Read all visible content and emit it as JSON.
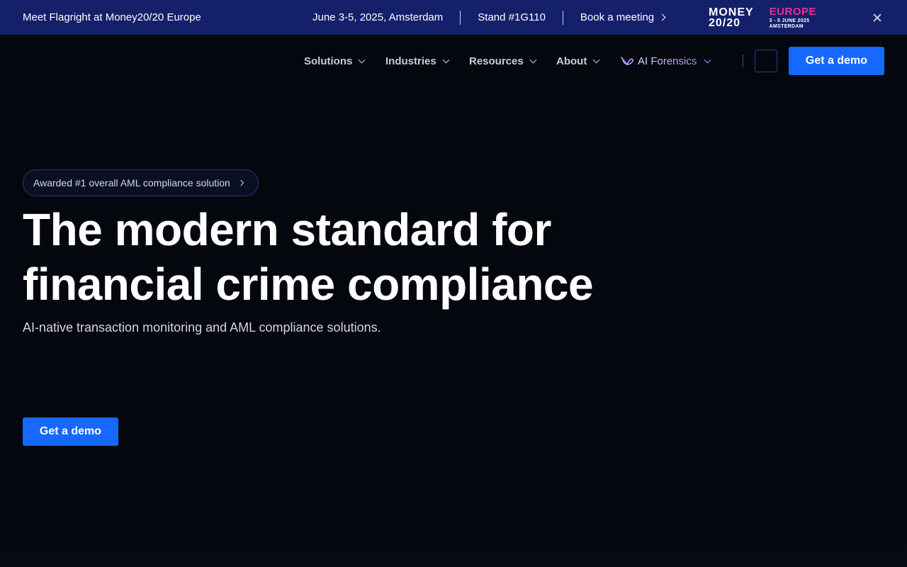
{
  "announcement": {
    "text": "Meet Flagright at Money20/20 Europe",
    "date_location": "June 3-5, 2025, Amsterdam",
    "stand": "Stand #1G110",
    "book_label": "Book a meeting",
    "event_logo": {
      "money_line1": "MONEY",
      "money_line2": "20/20",
      "region": "EUROPE",
      "dates": "3 - 5 JUNE 2025",
      "city": "AMSTERDAM"
    },
    "colors": {
      "background": "#14206a",
      "accent": "#e8318f"
    }
  },
  "nav": {
    "items": [
      {
        "label": "Solutions",
        "icon": "chevron-down-icon"
      },
      {
        "label": "Industries",
        "icon": "chevron-down-icon"
      },
      {
        "label": "Resources",
        "icon": "chevron-down-icon"
      },
      {
        "label": "About",
        "icon": "chevron-down-icon"
      }
    ],
    "ai_forensics": {
      "label": "AI Forensics",
      "icon": "ai-forensics-icon"
    },
    "cta_label": "Get a demo"
  },
  "hero": {
    "badge": "Awarded #1 overall AML compliance solution",
    "title_line1": "The modern standard for",
    "title_line2": "financial crime compliance",
    "subtitle": "AI-native transaction monitoring and AML compliance solutions.",
    "cta_label": "Get a demo"
  },
  "colors": {
    "page_background": "#05070f",
    "primary_button": "#1668ff"
  }
}
